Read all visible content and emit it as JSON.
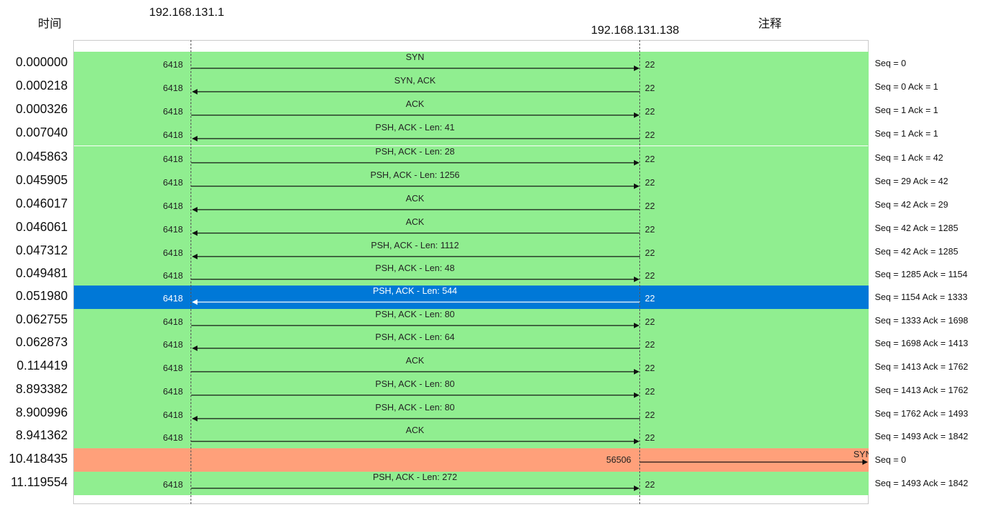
{
  "header": {
    "time_label": "时间",
    "host_a": "192.168.131.1",
    "host_b": "192.168.131.138",
    "notes_label": "注释"
  },
  "colors": {
    "normal": "#90ee90",
    "selected": "#0078d7",
    "new_connection": "#ffa07a"
  },
  "flows": [
    {
      "time": "0.000000",
      "src_port": "6418",
      "dst_port": "22",
      "label": "SYN",
      "dir": "right",
      "note": "Seq = 0"
    },
    {
      "time": "0.000218",
      "src_port": "6418",
      "dst_port": "22",
      "label": "SYN, ACK",
      "dir": "left",
      "note": "Seq = 0 Ack = 1"
    },
    {
      "time": "0.000326",
      "src_port": "6418",
      "dst_port": "22",
      "label": "ACK",
      "dir": "right",
      "note": "Seq = 1 Ack = 1"
    },
    {
      "time": "0.007040",
      "src_port": "6418",
      "dst_port": "22",
      "label": "PSH, ACK - Len: 41",
      "dir": "left",
      "note": "Seq = 1 Ack = 1"
    },
    {
      "time": "0.045863",
      "src_port": "6418",
      "dst_port": "22",
      "label": "PSH, ACK - Len: 28",
      "dir": "right",
      "note": "Seq = 1 Ack = 42"
    },
    {
      "time": "0.045905",
      "src_port": "6418",
      "dst_port": "22",
      "label": "PSH, ACK - Len: 1256",
      "dir": "right",
      "note": "Seq = 29 Ack = 42"
    },
    {
      "time": "0.046017",
      "src_port": "6418",
      "dst_port": "22",
      "label": "ACK",
      "dir": "left",
      "note": "Seq = 42 Ack = 29"
    },
    {
      "time": "0.046061",
      "src_port": "6418",
      "dst_port": "22",
      "label": "ACK",
      "dir": "left",
      "note": "Seq = 42 Ack = 1285"
    },
    {
      "time": "0.047312",
      "src_port": "6418",
      "dst_port": "22",
      "label": "PSH, ACK - Len: 1112",
      "dir": "left",
      "note": "Seq = 42 Ack = 1285"
    },
    {
      "time": "0.049481",
      "src_port": "6418",
      "dst_port": "22",
      "label": "PSH, ACK - Len: 48",
      "dir": "right",
      "note": "Seq = 1285 Ack = 1154"
    },
    {
      "time": "0.051980",
      "src_port": "6418",
      "dst_port": "22",
      "label": "PSH, ACK - Len: 544",
      "dir": "left",
      "note": "Seq = 1154 Ack = 1333",
      "selected": true
    },
    {
      "time": "0.062755",
      "src_port": "6418",
      "dst_port": "22",
      "label": "PSH, ACK - Len: 80",
      "dir": "right",
      "note": "Seq = 1333 Ack = 1698"
    },
    {
      "time": "0.062873",
      "src_port": "6418",
      "dst_port": "22",
      "label": "PSH, ACK - Len: 64",
      "dir": "left",
      "note": "Seq = 1698 Ack = 1413"
    },
    {
      "time": "0.114419",
      "src_port": "6418",
      "dst_port": "22",
      "label": "ACK",
      "dir": "right",
      "note": "Seq = 1413 Ack = 1762"
    },
    {
      "time": "8.893382",
      "src_port": "6418",
      "dst_port": "22",
      "label": "PSH, ACK - Len: 80",
      "dir": "right",
      "note": "Seq = 1413 Ack = 1762"
    },
    {
      "time": "8.900996",
      "src_port": "6418",
      "dst_port": "22",
      "label": "PSH, ACK - Len: 80",
      "dir": "left",
      "note": "Seq = 1762 Ack = 1493"
    },
    {
      "time": "8.941362",
      "src_port": "6418",
      "dst_port": "22",
      "label": "ACK",
      "dir": "right",
      "note": "Seq = 1493 Ack = 1842"
    },
    {
      "time": "10.418435",
      "src_port": "56506",
      "dst_port": "",
      "label": "SYN",
      "dir": "outside",
      "note": "Seq = 0",
      "new_connection": true
    },
    {
      "time": "11.119554",
      "src_port": "6418",
      "dst_port": "22",
      "label": "PSH, ACK - Len: 272",
      "dir": "right",
      "note": "Seq = 1493 Ack = 1842"
    }
  ]
}
